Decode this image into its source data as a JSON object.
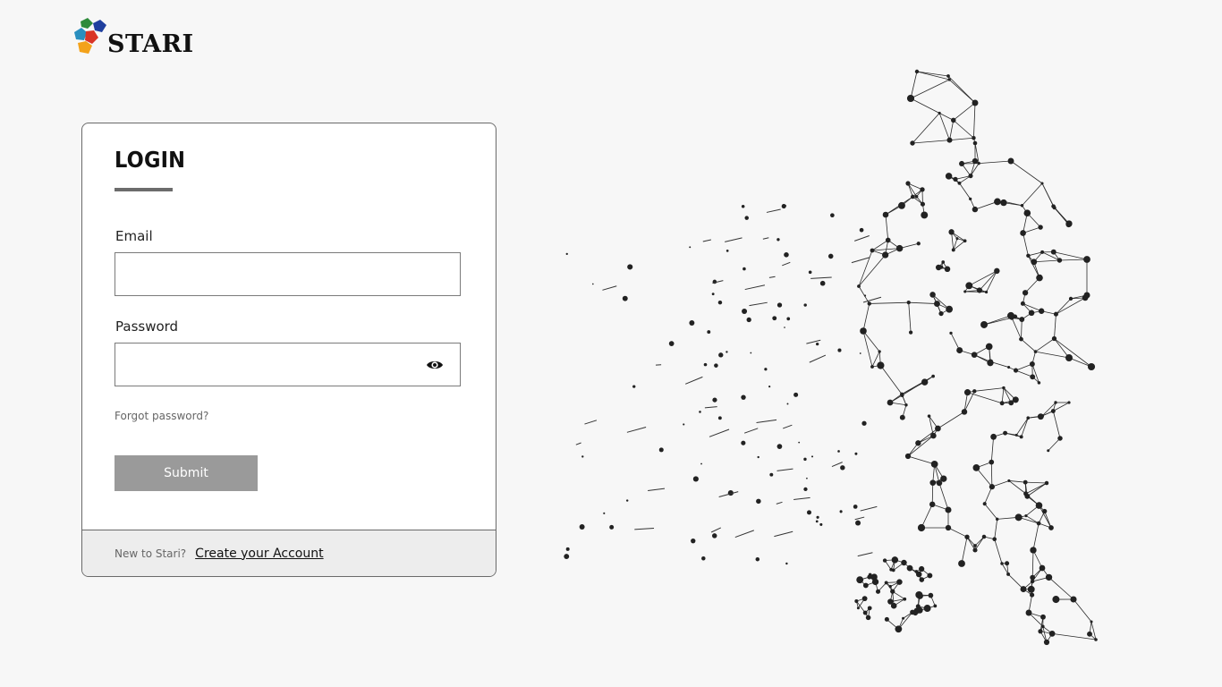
{
  "brand": {
    "name": "STARI",
    "logo_icon": "stari-petal-logo",
    "logo_colors": [
      "#2e8b3a",
      "#1f3f9e",
      "#d93426",
      "#f3a21a",
      "#2a8fbf"
    ]
  },
  "login": {
    "title": "LOGIN",
    "email_label": "Email",
    "email_value": "",
    "password_label": "Password",
    "password_value": "",
    "show_password_icon": "eye-icon",
    "forgot_password": "Forgot password?",
    "submit_label": "Submit"
  },
  "footer": {
    "prompt": "New to Stari?",
    "create_account": "Create your Account"
  },
  "illustration": {
    "icon": "polygonal-soccer-player-illustration"
  },
  "colors": {
    "background": "#f7f7f7",
    "submit_bg": "#9a9a9a",
    "footer_bg": "#ededed"
  }
}
